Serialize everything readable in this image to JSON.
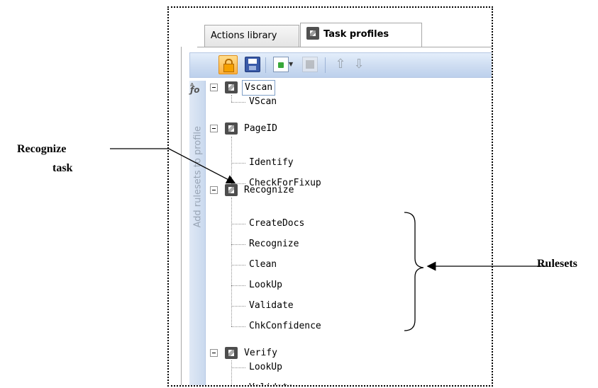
{
  "tabs": [
    {
      "label": "Actions library",
      "active": false
    },
    {
      "label": "Task profiles",
      "active": true
    }
  ],
  "toolbar": {
    "buttons": [
      {
        "name": "lock-icon",
        "active": true
      },
      {
        "name": "save-icon"
      },
      {
        "name": "add-document-icon"
      },
      {
        "name": "delete-icon",
        "enabled": false
      },
      {
        "name": "move-up-icon",
        "enabled": false
      },
      {
        "name": "move-down-icon",
        "enabled": false
      }
    ]
  },
  "side_panel": {
    "label": "Add rulesets to profile",
    "icon": "function-icon"
  },
  "tree": [
    {
      "label": "Vscan",
      "selected": true,
      "children": [
        "VScan"
      ]
    },
    {
      "label": "PageID",
      "children": [
        "Identify",
        "CheckForFixup"
      ]
    },
    {
      "label": "Recognize",
      "children": [
        "CreateDocs",
        "Recognize",
        "Clean",
        "LookUp",
        "Validate",
        "ChkConfidence"
      ]
    },
    {
      "label": "Verify",
      "children": [
        "LookUp",
        "Validate"
      ]
    }
  ],
  "annotations": {
    "recognize_task_line1": "Recognize",
    "recognize_task_line2": "task",
    "rulesets": "Rulesets"
  },
  "colors": {
    "toolbar": "#cddcf1",
    "lock_button": "#fbb040",
    "selection_border": "#7fa0c8"
  }
}
